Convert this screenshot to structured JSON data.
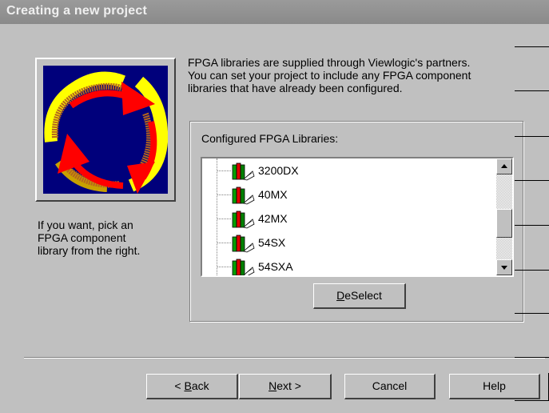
{
  "window": {
    "title": "Creating a new project"
  },
  "intro": {
    "line1": "FPGA libraries are supplied through Viewlogic's partners.",
    "line2": "You can set your project to include any FPGA component",
    "line3": "libraries that have already been configured."
  },
  "side_text": {
    "line1": "If you want, pick an",
    "line2": "FPGA component",
    "line3": "library from the right."
  },
  "group": {
    "label": "Configured FPGA Libraries:"
  },
  "libraries": [
    {
      "name": "3200DX",
      "icon": "library-books-icon"
    },
    {
      "name": "40MX",
      "icon": "library-books-icon"
    },
    {
      "name": "42MX",
      "icon": "library-books-icon"
    },
    {
      "name": "54SX",
      "icon": "library-books-icon"
    },
    {
      "name": "54SXA",
      "icon": "library-books-icon"
    }
  ],
  "scrollbar": {
    "position": 0.62
  },
  "buttons": {
    "deselect": {
      "key": "D",
      "rest": "eSelect"
    },
    "back": {
      "prefix": "< ",
      "key": "B",
      "rest": "ack"
    },
    "next": {
      "key": "N",
      "rest": "ext >"
    },
    "cancel": "Cancel",
    "help": "Help"
  },
  "colors": {
    "dialog": "#c0c0c0",
    "titlebar": "#8c8c8c",
    "image_bg": "#00007b",
    "arrow_red": "#ff0000",
    "ring_yellow": "#ffff00"
  }
}
